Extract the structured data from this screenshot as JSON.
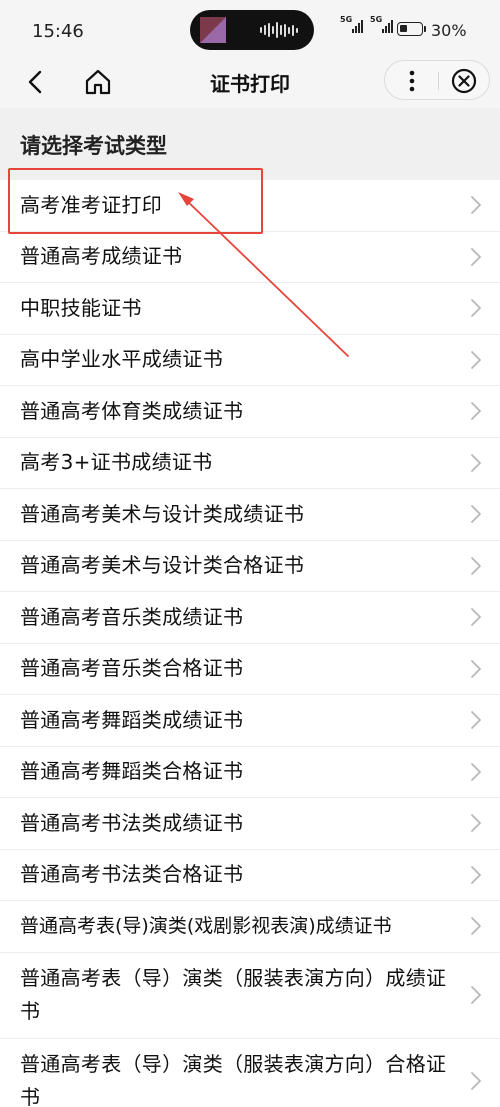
{
  "status_bar": {
    "time": "15:46",
    "signal1_label": "5G",
    "signal2_label": "5G",
    "battery_percent": "30%",
    "battery_level": 0.3
  },
  "nav": {
    "title": "证书打印",
    "icons": [
      "back-icon",
      "home-icon",
      "more-icon",
      "close-icon"
    ]
  },
  "section": {
    "title": "请选择考试类型"
  },
  "items": [
    {
      "label": "高考准考证打印"
    },
    {
      "label": "普通高考成绩证书"
    },
    {
      "label": "中职技能证书"
    },
    {
      "label": "高中学业水平成绩证书"
    },
    {
      "label": "普通高考体育类成绩证书"
    },
    {
      "label": "高考3+证书成绩证书"
    },
    {
      "label": "普通高考美术与设计类成绩证书"
    },
    {
      "label": "普通高考美术与设计类合格证书"
    },
    {
      "label": "普通高考音乐类成绩证书"
    },
    {
      "label": "普通高考音乐类合格证书"
    },
    {
      "label": "普通高考舞蹈类成绩证书"
    },
    {
      "label": "普通高考舞蹈类合格证书"
    },
    {
      "label": "普通高考书法类成绩证书"
    },
    {
      "label": "普通高考书法类合格证书"
    },
    {
      "label": "普通高考表(导)演类(戏剧影视表演)成绩证书"
    },
    {
      "label": "普通高考表（导）演类（服装表演方向）成绩证书"
    },
    {
      "label": "普通高考表（导）演类（服装表演方向）合格证书"
    }
  ],
  "colors": {
    "annotation": "#e8453a",
    "background": "#f5f5f5",
    "list_background": "#ffffff",
    "chevron": "#b8b8b8"
  }
}
